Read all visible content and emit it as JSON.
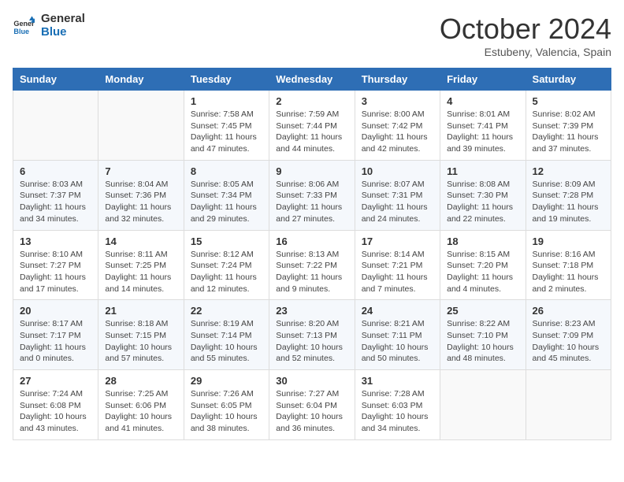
{
  "logo": {
    "line1": "General",
    "line2": "Blue"
  },
  "title": "October 2024",
  "location": "Estubeny, Valencia, Spain",
  "weekdays": [
    "Sunday",
    "Monday",
    "Tuesday",
    "Wednesday",
    "Thursday",
    "Friday",
    "Saturday"
  ],
  "weeks": [
    [
      {
        "day": "",
        "info": ""
      },
      {
        "day": "",
        "info": ""
      },
      {
        "day": "1",
        "info": "Sunrise: 7:58 AM\nSunset: 7:45 PM\nDaylight: 11 hours and 47 minutes."
      },
      {
        "day": "2",
        "info": "Sunrise: 7:59 AM\nSunset: 7:44 PM\nDaylight: 11 hours and 44 minutes."
      },
      {
        "day": "3",
        "info": "Sunrise: 8:00 AM\nSunset: 7:42 PM\nDaylight: 11 hours and 42 minutes."
      },
      {
        "day": "4",
        "info": "Sunrise: 8:01 AM\nSunset: 7:41 PM\nDaylight: 11 hours and 39 minutes."
      },
      {
        "day": "5",
        "info": "Sunrise: 8:02 AM\nSunset: 7:39 PM\nDaylight: 11 hours and 37 minutes."
      }
    ],
    [
      {
        "day": "6",
        "info": "Sunrise: 8:03 AM\nSunset: 7:37 PM\nDaylight: 11 hours and 34 minutes."
      },
      {
        "day": "7",
        "info": "Sunrise: 8:04 AM\nSunset: 7:36 PM\nDaylight: 11 hours and 32 minutes."
      },
      {
        "day": "8",
        "info": "Sunrise: 8:05 AM\nSunset: 7:34 PM\nDaylight: 11 hours and 29 minutes."
      },
      {
        "day": "9",
        "info": "Sunrise: 8:06 AM\nSunset: 7:33 PM\nDaylight: 11 hours and 27 minutes."
      },
      {
        "day": "10",
        "info": "Sunrise: 8:07 AM\nSunset: 7:31 PM\nDaylight: 11 hours and 24 minutes."
      },
      {
        "day": "11",
        "info": "Sunrise: 8:08 AM\nSunset: 7:30 PM\nDaylight: 11 hours and 22 minutes."
      },
      {
        "day": "12",
        "info": "Sunrise: 8:09 AM\nSunset: 7:28 PM\nDaylight: 11 hours and 19 minutes."
      }
    ],
    [
      {
        "day": "13",
        "info": "Sunrise: 8:10 AM\nSunset: 7:27 PM\nDaylight: 11 hours and 17 minutes."
      },
      {
        "day": "14",
        "info": "Sunrise: 8:11 AM\nSunset: 7:25 PM\nDaylight: 11 hours and 14 minutes."
      },
      {
        "day": "15",
        "info": "Sunrise: 8:12 AM\nSunset: 7:24 PM\nDaylight: 11 hours and 12 minutes."
      },
      {
        "day": "16",
        "info": "Sunrise: 8:13 AM\nSunset: 7:22 PM\nDaylight: 11 hours and 9 minutes."
      },
      {
        "day": "17",
        "info": "Sunrise: 8:14 AM\nSunset: 7:21 PM\nDaylight: 11 hours and 7 minutes."
      },
      {
        "day": "18",
        "info": "Sunrise: 8:15 AM\nSunset: 7:20 PM\nDaylight: 11 hours and 4 minutes."
      },
      {
        "day": "19",
        "info": "Sunrise: 8:16 AM\nSunset: 7:18 PM\nDaylight: 11 hours and 2 minutes."
      }
    ],
    [
      {
        "day": "20",
        "info": "Sunrise: 8:17 AM\nSunset: 7:17 PM\nDaylight: 11 hours and 0 minutes."
      },
      {
        "day": "21",
        "info": "Sunrise: 8:18 AM\nSunset: 7:15 PM\nDaylight: 10 hours and 57 minutes."
      },
      {
        "day": "22",
        "info": "Sunrise: 8:19 AM\nSunset: 7:14 PM\nDaylight: 10 hours and 55 minutes."
      },
      {
        "day": "23",
        "info": "Sunrise: 8:20 AM\nSunset: 7:13 PM\nDaylight: 10 hours and 52 minutes."
      },
      {
        "day": "24",
        "info": "Sunrise: 8:21 AM\nSunset: 7:11 PM\nDaylight: 10 hours and 50 minutes."
      },
      {
        "day": "25",
        "info": "Sunrise: 8:22 AM\nSunset: 7:10 PM\nDaylight: 10 hours and 48 minutes."
      },
      {
        "day": "26",
        "info": "Sunrise: 8:23 AM\nSunset: 7:09 PM\nDaylight: 10 hours and 45 minutes."
      }
    ],
    [
      {
        "day": "27",
        "info": "Sunrise: 7:24 AM\nSunset: 6:08 PM\nDaylight: 10 hours and 43 minutes."
      },
      {
        "day": "28",
        "info": "Sunrise: 7:25 AM\nSunset: 6:06 PM\nDaylight: 10 hours and 41 minutes."
      },
      {
        "day": "29",
        "info": "Sunrise: 7:26 AM\nSunset: 6:05 PM\nDaylight: 10 hours and 38 minutes."
      },
      {
        "day": "30",
        "info": "Sunrise: 7:27 AM\nSunset: 6:04 PM\nDaylight: 10 hours and 36 minutes."
      },
      {
        "day": "31",
        "info": "Sunrise: 7:28 AM\nSunset: 6:03 PM\nDaylight: 10 hours and 34 minutes."
      },
      {
        "day": "",
        "info": ""
      },
      {
        "day": "",
        "info": ""
      }
    ]
  ]
}
